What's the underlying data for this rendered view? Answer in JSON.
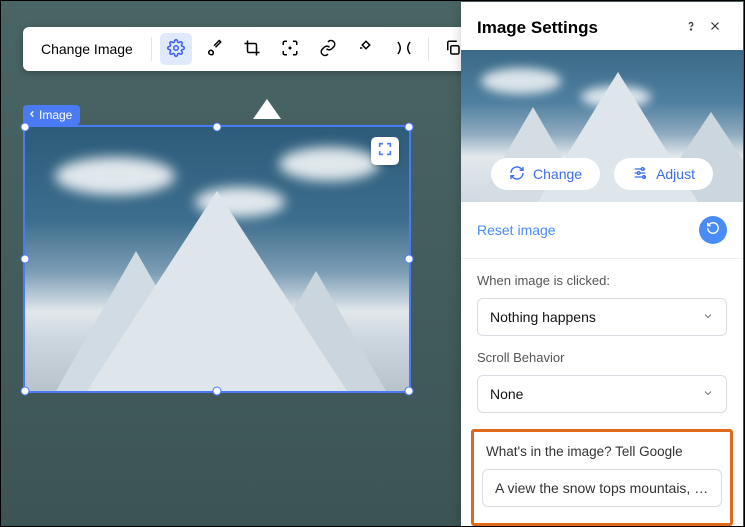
{
  "toolbar": {
    "change_label": "Change Image"
  },
  "breadcrumb": {
    "label": "Image"
  },
  "panel": {
    "title": "Image Settings",
    "change_btn": "Change",
    "adjust_btn": "Adjust",
    "reset_link": "Reset image",
    "click_section": {
      "label": "When image is clicked:",
      "value": "Nothing happens"
    },
    "scroll_section": {
      "label": "Scroll Behavior",
      "value": "None"
    },
    "alt_section": {
      "label": "What's in the image? Tell Google",
      "value": "A view the snow tops mountais, ever…"
    }
  }
}
